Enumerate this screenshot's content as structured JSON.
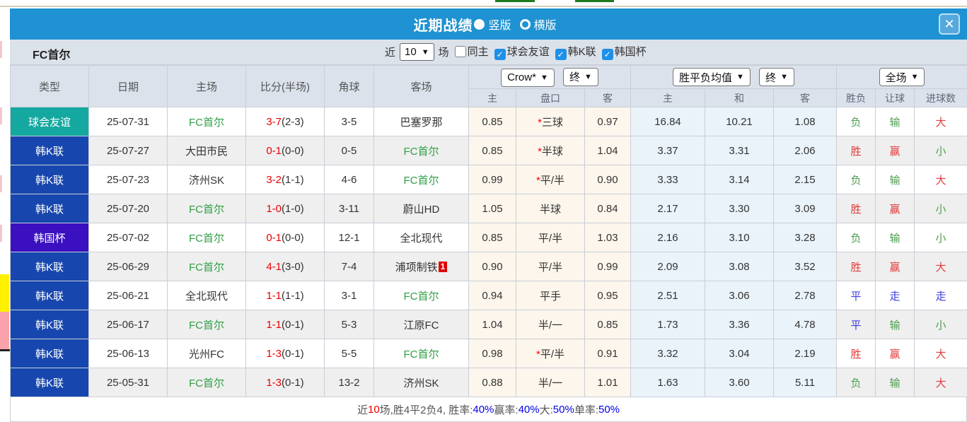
{
  "modal": {
    "title": "近期战绩",
    "view_options": [
      {
        "label": "竖版",
        "selected": true
      },
      {
        "label": "横版",
        "selected": false
      }
    ],
    "close_glyph": "✕"
  },
  "filter": {
    "team": "FC首尔",
    "recent_label": "近",
    "recent_value": "10",
    "matches_label": "场",
    "checkboxes": [
      {
        "label": "同主",
        "checked": false
      },
      {
        "label": "球会友谊",
        "checked": true
      },
      {
        "label": "韩K联",
        "checked": true
      },
      {
        "label": "韩国杯",
        "checked": true
      }
    ]
  },
  "table": {
    "columns": [
      "类型",
      "日期",
      "主场",
      "比分(半场)",
      "角球",
      "客场"
    ],
    "odds_groups": [
      {
        "selects": [
          "Crow*",
          "终"
        ],
        "sub": [
          "主",
          "盘口",
          "客"
        ]
      },
      {
        "selects": [
          "胜平负均值",
          "终"
        ],
        "sub": [
          "主",
          "和",
          "客"
        ]
      },
      {
        "selects": [
          "全场"
        ],
        "sub": [
          "胜负",
          "让球",
          "进球数"
        ]
      }
    ],
    "type_colors": {
      "球会友谊": "#14A8A0",
      "韩K联": "#1747AE",
      "韩国杯": "#3A10C0"
    },
    "rows": [
      {
        "type": "球会友谊",
        "date": "25-07-31",
        "home": "FC首尔",
        "home_is_team": true,
        "score": "3-7",
        "half": "(2-3)",
        "corner": "3-5",
        "away": "巴塞罗那",
        "away_is_team": false,
        "away_rank": "",
        "ah": {
          "home": "0.85",
          "star": true,
          "line": "三球",
          "away": "0.97"
        },
        "eu": {
          "home": "16.84",
          "draw": "10.21",
          "away": "1.08"
        },
        "results": [
          {
            "text": "负",
            "c": "green"
          },
          {
            "text": "输",
            "c": "green"
          },
          {
            "text": "大",
            "c": "red"
          }
        ]
      },
      {
        "type": "韩K联",
        "date": "25-07-27",
        "home": "大田市民",
        "home_is_team": false,
        "score": "0-1",
        "half": "(0-0)",
        "corner": "0-5",
        "away": "FC首尔",
        "away_is_team": true,
        "away_rank": "",
        "ah": {
          "home": "0.85",
          "star": true,
          "line": "半球",
          "away": "1.04"
        },
        "eu": {
          "home": "3.37",
          "draw": "3.31",
          "away": "2.06"
        },
        "results": [
          {
            "text": "胜",
            "c": "red"
          },
          {
            "text": "赢",
            "c": "red"
          },
          {
            "text": "小",
            "c": "green"
          }
        ]
      },
      {
        "type": "韩K联",
        "date": "25-07-23",
        "home": "济州SK",
        "home_is_team": false,
        "score": "3-2",
        "half": "(1-1)",
        "corner": "4-6",
        "away": "FC首尔",
        "away_is_team": true,
        "away_rank": "",
        "ah": {
          "home": "0.99",
          "star": true,
          "line": "平/半",
          "away": "0.90"
        },
        "eu": {
          "home": "3.33",
          "draw": "3.14",
          "away": "2.15"
        },
        "results": [
          {
            "text": "负",
            "c": "green"
          },
          {
            "text": "输",
            "c": "green"
          },
          {
            "text": "大",
            "c": "red"
          }
        ]
      },
      {
        "type": "韩K联",
        "date": "25-07-20",
        "home": "FC首尔",
        "home_is_team": true,
        "score": "1-0",
        "half": "(1-0)",
        "corner": "3-11",
        "away": "蔚山HD",
        "away_is_team": false,
        "away_rank": "",
        "ah": {
          "home": "1.05",
          "star": false,
          "line": "半球",
          "away": "0.84"
        },
        "eu": {
          "home": "2.17",
          "draw": "3.30",
          "away": "3.09"
        },
        "results": [
          {
            "text": "胜",
            "c": "red"
          },
          {
            "text": "赢",
            "c": "red"
          },
          {
            "text": "小",
            "c": "green"
          }
        ]
      },
      {
        "type": "韩国杯",
        "date": "25-07-02",
        "home": "FC首尔",
        "home_is_team": true,
        "score": "0-1",
        "half": "(0-0)",
        "corner": "12-1",
        "away": "全北现代",
        "away_is_team": false,
        "away_rank": "",
        "ah": {
          "home": "0.85",
          "star": false,
          "line": "平/半",
          "away": "1.03"
        },
        "eu": {
          "home": "2.16",
          "draw": "3.10",
          "away": "3.28"
        },
        "results": [
          {
            "text": "负",
            "c": "green"
          },
          {
            "text": "输",
            "c": "green"
          },
          {
            "text": "小",
            "c": "green"
          }
        ]
      },
      {
        "type": "韩K联",
        "date": "25-06-29",
        "home": "FC首尔",
        "home_is_team": true,
        "score": "4-1",
        "half": "(3-0)",
        "corner": "7-4",
        "away": "浦项制铁",
        "away_is_team": false,
        "away_rank": "1",
        "ah": {
          "home": "0.90",
          "star": false,
          "line": "平/半",
          "away": "0.99"
        },
        "eu": {
          "home": "2.09",
          "draw": "3.08",
          "away": "3.52"
        },
        "results": [
          {
            "text": "胜",
            "c": "red"
          },
          {
            "text": "赢",
            "c": "red"
          },
          {
            "text": "大",
            "c": "red"
          }
        ]
      },
      {
        "type": "韩K联",
        "date": "25-06-21",
        "home": "全北现代",
        "home_is_team": false,
        "score": "1-1",
        "half": "(1-1)",
        "corner": "3-1",
        "away": "FC首尔",
        "away_is_team": true,
        "away_rank": "",
        "ah": {
          "home": "0.94",
          "star": false,
          "line": "平手",
          "away": "0.95"
        },
        "eu": {
          "home": "2.51",
          "draw": "3.06",
          "away": "2.78"
        },
        "results": [
          {
            "text": "平",
            "c": "blue"
          },
          {
            "text": "走",
            "c": "blue"
          },
          {
            "text": "走",
            "c": "blue"
          }
        ]
      },
      {
        "type": "韩K联",
        "date": "25-06-17",
        "home": "FC首尔",
        "home_is_team": true,
        "score": "1-1",
        "half": "(0-1)",
        "corner": "5-3",
        "away": "江原FC",
        "away_is_team": false,
        "away_rank": "",
        "ah": {
          "home": "1.04",
          "star": false,
          "line": "半/一",
          "away": "0.85"
        },
        "eu": {
          "home": "1.73",
          "draw": "3.36",
          "away": "4.78"
        },
        "results": [
          {
            "text": "平",
            "c": "blue"
          },
          {
            "text": "输",
            "c": "green"
          },
          {
            "text": "小",
            "c": "green"
          }
        ]
      },
      {
        "type": "韩K联",
        "date": "25-06-13",
        "home": "光州FC",
        "home_is_team": false,
        "score": "1-3",
        "half": "(0-1)",
        "corner": "5-5",
        "away": "FC首尔",
        "away_is_team": true,
        "away_rank": "",
        "ah": {
          "home": "0.98",
          "star": true,
          "line": "平/半",
          "away": "0.91"
        },
        "eu": {
          "home": "3.32",
          "draw": "3.04",
          "away": "2.19"
        },
        "results": [
          {
            "text": "胜",
            "c": "red"
          },
          {
            "text": "赢",
            "c": "red"
          },
          {
            "text": "大",
            "c": "red"
          }
        ]
      },
      {
        "type": "韩K联",
        "date": "25-05-31",
        "home": "FC首尔",
        "home_is_team": true,
        "score": "1-3",
        "half": "(0-1)",
        "corner": "13-2",
        "away": "济州SK",
        "away_is_team": false,
        "away_rank": "",
        "ah": {
          "home": "0.88",
          "star": false,
          "line": "半/一",
          "away": "1.01"
        },
        "eu": {
          "home": "1.63",
          "draw": "3.60",
          "away": "5.11"
        },
        "results": [
          {
            "text": "负",
            "c": "green"
          },
          {
            "text": "输",
            "c": "green"
          },
          {
            "text": "大",
            "c": "red"
          }
        ]
      }
    ]
  },
  "summary": {
    "segments": [
      {
        "text": "近",
        "c": "gray"
      },
      {
        "text": "10",
        "c": "red"
      },
      {
        "text": "场,胜4平2负4, 胜率:",
        "c": "gray"
      },
      {
        "text": "40%",
        "c": "blue"
      },
      {
        "text": " 赢率:",
        "c": "gray"
      },
      {
        "text": "40%",
        "c": "blue"
      },
      {
        "text": " 大:",
        "c": "gray"
      },
      {
        "text": "50%",
        "c": "blue"
      },
      {
        "text": " 单率:",
        "c": "gray"
      },
      {
        "text": "50%",
        "c": "blue"
      }
    ]
  },
  "colors": {
    "titlebar_bg": "#1E92D2",
    "type_friendly": "#14A8A0",
    "type_kleague": "#1747AE",
    "type_cup": "#3A10C0",
    "team_green": "#2F9E44",
    "score_red": "#EE0000",
    "result_red": "#E23A3A",
    "result_green": "#4D9E50",
    "result_blue": "#3C3CDE",
    "handicap_bg": "#FCF6EC",
    "europe_bg": "#EAF3FA"
  }
}
